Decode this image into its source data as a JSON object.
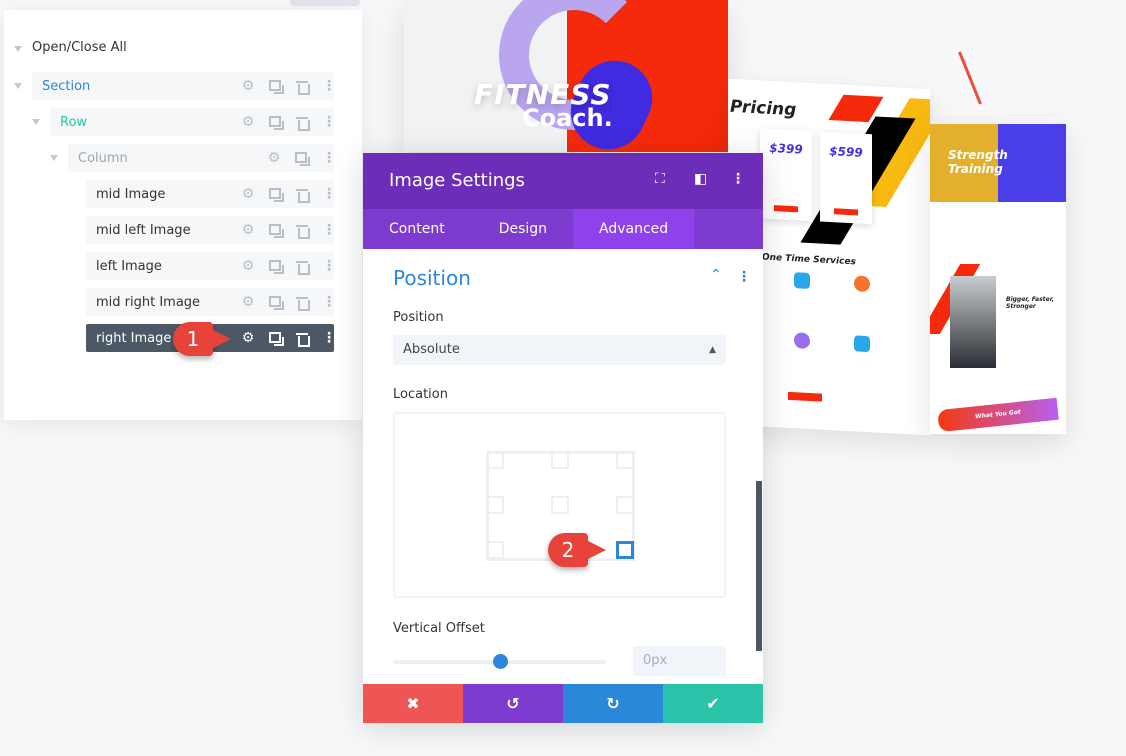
{
  "background": {
    "hero": {
      "title_1": "FITNESS",
      "title_2": "Coach."
    },
    "pricing": {
      "title": "Pricing",
      "prices": [
        "$399",
        "$599"
      ],
      "services_title": "One Time Services"
    },
    "strength": {
      "title_1": "Strength",
      "title_2": "Training",
      "subtitle": "Bigger, Faster, Stronger",
      "footer": "What You Got"
    }
  },
  "layers": {
    "open_close_all": "Open/Close All",
    "section": "Section",
    "row": "Row",
    "column": "Column",
    "items": [
      {
        "label": "mid Image",
        "selected": false
      },
      {
        "label": "mid left Image",
        "selected": false
      },
      {
        "label": "left Image",
        "selected": false
      },
      {
        "label": "mid right Image",
        "selected": false
      },
      {
        "label": "right Image",
        "selected": true
      }
    ],
    "colors": {
      "section": "#2b87da",
      "row": "#29c4a9",
      "column": "#9ea6af",
      "selected_bg": "#4c5866"
    }
  },
  "badges": {
    "step1": "1",
    "step2": "2",
    "color": "#e8433a"
  },
  "modal": {
    "title": "Image Settings",
    "tabs": [
      {
        "label": "Content"
      },
      {
        "label": "Design"
      },
      {
        "label": "Advanced",
        "active": true
      }
    ],
    "section_title": "Position",
    "position_label": "Position",
    "position_value": "Absolute",
    "location_label": "Location",
    "location_selected": "bottom-right",
    "vertical_offset_label": "Vertical Offset",
    "vertical_offset_value": "0px",
    "vertical_offset_slider_percent": 50,
    "footer": {
      "cancel": "✖",
      "undo": "↺",
      "redo": "↻",
      "save": "✔"
    },
    "colors": {
      "header": "#6c2eb9",
      "tabs": "#7e3bd0",
      "active_tab": "#8f42ec",
      "cancel": "#ef5555",
      "undo": "#7d3bcf",
      "redo": "#2b87da",
      "save": "#29c4a9"
    }
  }
}
